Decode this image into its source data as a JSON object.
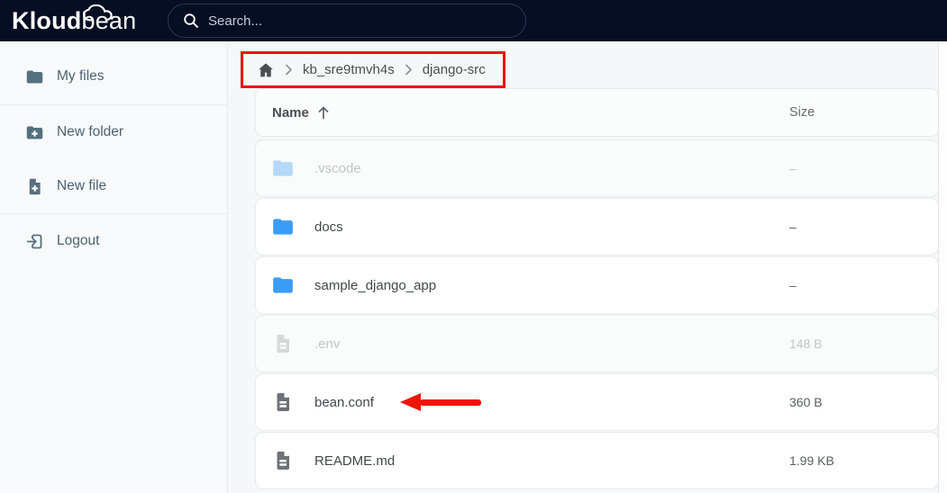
{
  "navbar": {
    "logo_bold": "Kloud",
    "logo_light": "bean",
    "search_placeholder": "Search..."
  },
  "sidebar": {
    "items": [
      {
        "label": "My files",
        "icon": "folder-icon"
      },
      {
        "label": "New folder",
        "icon": "folder-plus-icon"
      },
      {
        "label": "New file",
        "icon": "file-plus-icon"
      },
      {
        "label": "Logout",
        "icon": "logout-icon"
      }
    ]
  },
  "breadcrumb": {
    "home_icon": "home-icon",
    "items": [
      "kb_sre9tmvh4s",
      "django-src"
    ]
  },
  "table": {
    "columns": {
      "name": "Name",
      "size": "Size"
    },
    "sort": "name-ascending",
    "rows": [
      {
        "name": ".vscode",
        "type": "folder",
        "size": "–",
        "hidden": true
      },
      {
        "name": "docs",
        "type": "folder",
        "size": "–",
        "hidden": false
      },
      {
        "name": "sample_django_app",
        "type": "folder",
        "size": "–",
        "hidden": false
      },
      {
        "name": ".env",
        "type": "file",
        "size": "148 B",
        "hidden": true
      },
      {
        "name": "bean.conf",
        "type": "file",
        "size": "360 B",
        "hidden": false
      },
      {
        "name": "README.md",
        "type": "file",
        "size": "1.99 KB",
        "hidden": false
      }
    ]
  },
  "annotations": {
    "color": "#e8150a",
    "highlight_box_target": "breadcrumb",
    "arrow_target": "bean.conf"
  },
  "colors": {
    "navbar_bg": "#050e22",
    "folder_icon": "#3b9df5",
    "file_icon": "#6e7276",
    "sidebar_icon": "#54707f"
  }
}
